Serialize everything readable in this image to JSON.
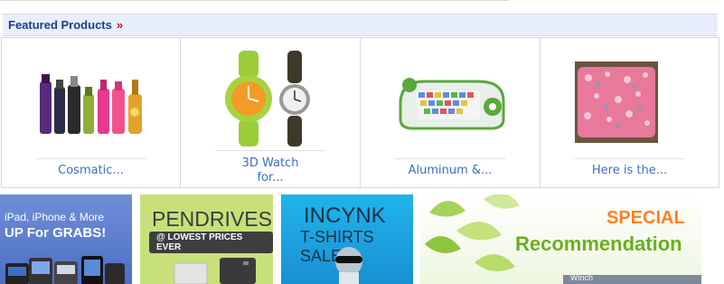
{
  "section": {
    "title": "Featured Products",
    "arrow": "»"
  },
  "products": [
    {
      "caption": "Cosmatic...",
      "icon": "cosmetics-bottles-image"
    },
    {
      "caption": "3D Watch\nfor...",
      "icon": "watches-image"
    },
    {
      "caption": "Aluminum &...",
      "icon": "kids-keyboard-toy-image"
    },
    {
      "caption": "Here is the...",
      "icon": "pink-pillow-image"
    }
  ],
  "banners": {
    "ipad": {
      "line1": "iPad, iPhone & More",
      "line2": "UP For GRABS!"
    },
    "pendrives": {
      "title": "PENDRIVES",
      "pill": "@ LOWEST PRICES EVER"
    },
    "incynk": {
      "title": "INCYNK",
      "subtitle": "T-SHIRTS SALE"
    },
    "special": {
      "line1": "SPECIAL",
      "line2": "Recommendation",
      "strip": "Winch"
    }
  },
  "colors": {
    "header_bg": "#e8eefb",
    "header_text": "#1d3e8a",
    "link": "#3b6fc4",
    "accent_red": "#cc1111"
  }
}
